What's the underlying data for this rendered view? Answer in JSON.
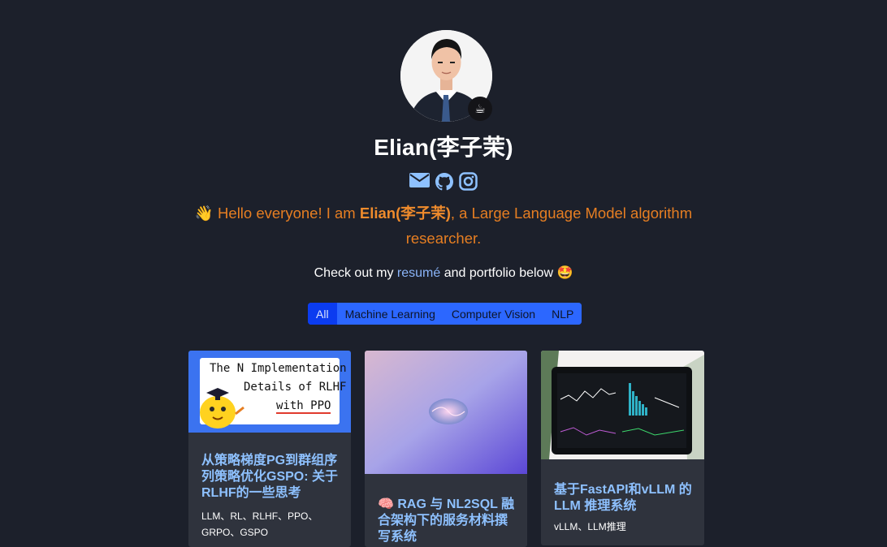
{
  "profile": {
    "name": "Elian(李子茉)",
    "badge_emoji": "☕"
  },
  "intro": {
    "wave": "👋",
    "prefix": " Hello everyone! I am ",
    "name": "Elian(李子茉)",
    "suffix": ", a Large Language Model algorithm researcher."
  },
  "checkout": {
    "prefix": "Check out my ",
    "resume_link": "resumé",
    "suffix": " and portfolio below ",
    "emoji": "🤩"
  },
  "filters": [
    "All",
    "Machine Learning",
    "Computer Vision",
    "NLP"
  ],
  "cards": [
    {
      "thumb_lines": [
        "The N Implementation",
        "Details of RLHF",
        "with PPO"
      ],
      "title": "从策略梯度PG到群组序列策略优化GSPO: 关于RLHF的一些思考",
      "tags": "LLM、RL、RLHF、PPO、GRPO、GSPO"
    },
    {
      "title": "🧠 RAG 与 NL2SQL 融合架构下的服务材料撰写系统",
      "tags": ""
    },
    {
      "title": "基于FastAPI和vLLM 的 LLM 推理系统",
      "tags": "vLLM、LLM推理"
    }
  ],
  "colors": {
    "background": "#1c202b",
    "accent_orange": "#e67e22",
    "link_blue": "#8ab4f8",
    "filter_blue": "#2c67ff"
  }
}
